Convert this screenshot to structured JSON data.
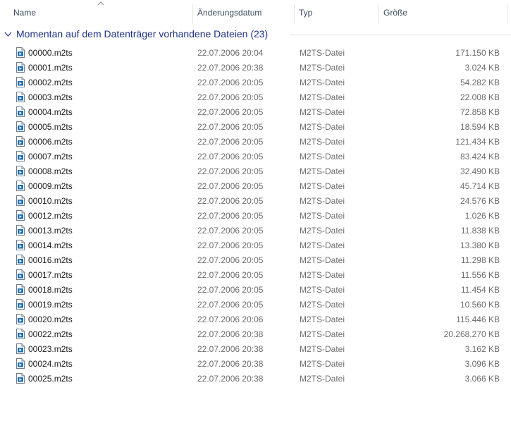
{
  "columns": {
    "name": "Name",
    "date": "Änderungsdatum",
    "type": "Typ",
    "size": "Größe"
  },
  "group": {
    "title": "Momentan auf dem Datenträger vorhandene Dateien (23)"
  },
  "icons": {
    "sort": "chevron-up-icon",
    "group": "chevron-down-icon",
    "file": "video-file-icon"
  },
  "colors": {
    "group_title": "#1e3287",
    "file_icon": "#1b6fb8"
  },
  "files": [
    {
      "name": "00000.m2ts",
      "date": "22.07.2006 20:04",
      "type": "M2TS-Datei",
      "size": "171.150 KB"
    },
    {
      "name": "00001.m2ts",
      "date": "22.07.2006 20:38",
      "type": "M2TS-Datei",
      "size": "3.024 KB"
    },
    {
      "name": "00002.m2ts",
      "date": "22.07.2006 20:05",
      "type": "M2TS-Datei",
      "size": "54.282 KB"
    },
    {
      "name": "00003.m2ts",
      "date": "22.07.2006 20:05",
      "type": "M2TS-Datei",
      "size": "22.008 KB"
    },
    {
      "name": "00004.m2ts",
      "date": "22.07.2006 20:05",
      "type": "M2TS-Datei",
      "size": "72.858 KB"
    },
    {
      "name": "00005.m2ts",
      "date": "22.07.2006 20:05",
      "type": "M2TS-Datei",
      "size": "18.594 KB"
    },
    {
      "name": "00006.m2ts",
      "date": "22.07.2006 20:05",
      "type": "M2TS-Datei",
      "size": "121.434 KB"
    },
    {
      "name": "00007.m2ts",
      "date": "22.07.2006 20:05",
      "type": "M2TS-Datei",
      "size": "83.424 KB"
    },
    {
      "name": "00008.m2ts",
      "date": "22.07.2006 20:05",
      "type": "M2TS-Datei",
      "size": "32.490 KB"
    },
    {
      "name": "00009.m2ts",
      "date": "22.07.2006 20:05",
      "type": "M2TS-Datei",
      "size": "45.714 KB"
    },
    {
      "name": "00010.m2ts",
      "date": "22.07.2006 20:05",
      "type": "M2TS-Datei",
      "size": "24.576 KB"
    },
    {
      "name": "00012.m2ts",
      "date": "22.07.2006 20:05",
      "type": "M2TS-Datei",
      "size": "1.026 KB"
    },
    {
      "name": "00013.m2ts",
      "date": "22.07.2006 20:05",
      "type": "M2TS-Datei",
      "size": "11.838 KB"
    },
    {
      "name": "00014.m2ts",
      "date": "22.07.2006 20:05",
      "type": "M2TS-Datei",
      "size": "13.380 KB"
    },
    {
      "name": "00016.m2ts",
      "date": "22.07.2006 20:05",
      "type": "M2TS-Datei",
      "size": "11.298 KB"
    },
    {
      "name": "00017.m2ts",
      "date": "22.07.2006 20:05",
      "type": "M2TS-Datei",
      "size": "11.556 KB"
    },
    {
      "name": "00018.m2ts",
      "date": "22.07.2006 20:05",
      "type": "M2TS-Datei",
      "size": "11.454 KB"
    },
    {
      "name": "00019.m2ts",
      "date": "22.07.2006 20:05",
      "type": "M2TS-Datei",
      "size": "10.560 KB"
    },
    {
      "name": "00020.m2ts",
      "date": "22.07.2006 20:06",
      "type": "M2TS-Datei",
      "size": "115.446 KB"
    },
    {
      "name": "00022.m2ts",
      "date": "22.07.2006 20:38",
      "type": "M2TS-Datei",
      "size": "20.268.270 KB"
    },
    {
      "name": "00023.m2ts",
      "date": "22.07.2006 20:38",
      "type": "M2TS-Datei",
      "size": "3.162 KB"
    },
    {
      "name": "00024.m2ts",
      "date": "22.07.2006 20:38",
      "type": "M2TS-Datei",
      "size": "3.096 KB"
    },
    {
      "name": "00025.m2ts",
      "date": "22.07.2006 20:38",
      "type": "M2TS-Datei",
      "size": "3.066 KB"
    }
  ]
}
